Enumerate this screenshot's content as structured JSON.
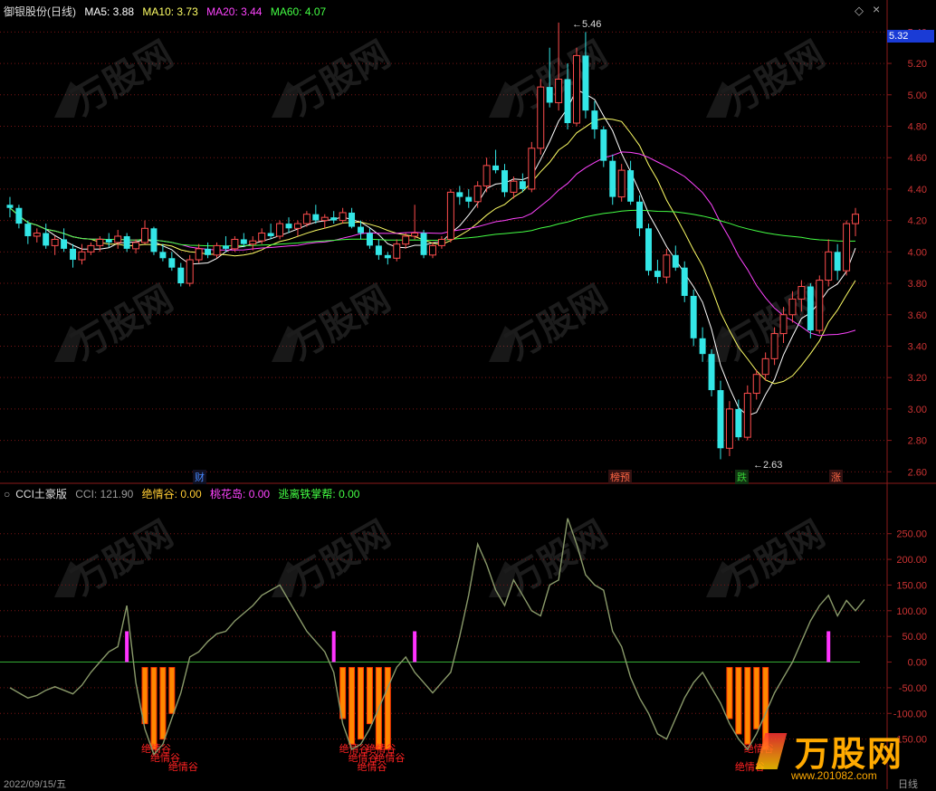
{
  "header": {
    "stock_title": "御银股份(日线)",
    "ma5": "MA5: 3.88",
    "ma10": "MA10: 3.73",
    "ma20": "MA20: 3.44",
    "ma60": "MA60: 4.07",
    "colors": {
      "ma5": "#ffffff",
      "ma10": "#ffff66",
      "ma20": "#ff44ff",
      "ma60": "#44ff44"
    }
  },
  "price_axis": {
    "current_price": "5.32",
    "ticks": [
      "5.40",
      "5.20",
      "5.00",
      "4.80",
      "4.60",
      "4.40",
      "4.20",
      "4.00",
      "3.80",
      "3.60",
      "3.40",
      "3.20",
      "3.00",
      "2.80",
      "2.60"
    ],
    "ylim": [
      2.55,
      5.5
    ]
  },
  "annotations": {
    "high_label": "5.46",
    "low_label": "2.63",
    "events": [
      {
        "text": "财",
        "color": "#4488ff"
      },
      {
        "text": "榜预",
        "color": "#ff6644"
      },
      {
        "text": "跌",
        "color": "#33cc33"
      },
      {
        "text": "涨",
        "color": "#ff6644"
      }
    ]
  },
  "indicator": {
    "title": "CCI土豪版",
    "cci": "CCI: 121.90",
    "jueqinggu": "绝情谷: 0.00",
    "taohuadao": "桃花岛: 0.00",
    "taolijunzhang": "逃离铁掌帮: 0.00",
    "ticks": [
      "250.00",
      "200.00",
      "150.00",
      "100.00",
      "50.00",
      "0.00",
      "-50.00",
      "-100.00",
      "-150.00"
    ],
    "ylim": [
      -230,
      320
    ],
    "signal_label": "绝情谷"
  },
  "bottom": {
    "date_label": "2022/09/15/五",
    "period_label": "日线"
  },
  "watermark": {
    "brand": "万股网",
    "url": "www.201082.com"
  },
  "chart_data": {
    "type": "candlestick",
    "ohlc": [
      [
        4.3,
        4.35,
        4.22,
        4.28
      ],
      [
        4.28,
        4.3,
        4.15,
        4.18
      ],
      [
        4.18,
        4.2,
        4.05,
        4.1
      ],
      [
        4.1,
        4.15,
        4.06,
        4.12
      ],
      [
        4.12,
        4.18,
        4.02,
        4.04
      ],
      [
        4.04,
        4.1,
        3.98,
        4.08
      ],
      [
        4.08,
        4.15,
        4.0,
        4.02
      ],
      [
        4.02,
        4.05,
        3.9,
        3.95
      ],
      [
        3.95,
        4.05,
        3.92,
        4.0
      ],
      [
        4.0,
        4.06,
        3.98,
        4.04
      ],
      [
        4.04,
        4.1,
        4.0,
        4.08
      ],
      [
        4.08,
        4.12,
        4.03,
        4.06
      ],
      [
        4.06,
        4.14,
        4.02,
        4.1
      ],
      [
        4.1,
        4.12,
        4.0,
        4.02
      ],
      [
        4.02,
        4.08,
        3.99,
        4.06
      ],
      [
        4.06,
        4.2,
        4.05,
        4.15
      ],
      [
        4.15,
        4.16,
        3.98,
        4.0
      ],
      [
        4.0,
        4.05,
        3.94,
        3.96
      ],
      [
        3.96,
        4.0,
        3.88,
        3.9
      ],
      [
        3.9,
        3.93,
        3.78,
        3.8
      ],
      [
        3.8,
        3.98,
        3.78,
        3.95
      ],
      [
        3.95,
        4.05,
        3.93,
        4.02
      ],
      [
        4.02,
        4.06,
        3.96,
        3.98
      ],
      [
        3.98,
        4.06,
        3.96,
        4.04
      ],
      [
        4.04,
        4.1,
        4.0,
        4.02
      ],
      [
        4.02,
        4.1,
        4.0,
        4.08
      ],
      [
        4.08,
        4.12,
        4.03,
        4.05
      ],
      [
        4.05,
        4.1,
        4.01,
        4.07
      ],
      [
        4.07,
        4.15,
        4.05,
        4.12
      ],
      [
        4.12,
        4.18,
        4.08,
        4.1
      ],
      [
        4.1,
        4.2,
        4.08,
        4.18
      ],
      [
        4.18,
        4.22,
        4.12,
        4.15
      ],
      [
        4.15,
        4.2,
        4.1,
        4.18
      ],
      [
        4.18,
        4.26,
        4.16,
        4.24
      ],
      [
        4.24,
        4.3,
        4.18,
        4.2
      ],
      [
        4.2,
        4.24,
        4.15,
        4.22
      ],
      [
        4.22,
        4.26,
        4.18,
        4.2
      ],
      [
        4.2,
        4.28,
        4.18,
        4.25
      ],
      [
        4.25,
        4.28,
        4.15,
        4.16
      ],
      [
        4.16,
        4.2,
        4.08,
        4.12
      ],
      [
        4.12,
        4.15,
        4.02,
        4.04
      ],
      [
        4.04,
        4.08,
        3.95,
        3.98
      ],
      [
        3.98,
        4.0,
        3.92,
        3.96
      ],
      [
        3.96,
        4.08,
        3.94,
        4.05
      ],
      [
        4.05,
        4.12,
        4.02,
        4.1
      ],
      [
        4.1,
        4.3,
        4.08,
        4.12
      ],
      [
        4.12,
        4.14,
        3.96,
        3.98
      ],
      [
        3.98,
        4.06,
        3.96,
        4.04
      ],
      [
        4.04,
        4.1,
        4.02,
        4.08
      ],
      [
        4.08,
        4.4,
        4.06,
        4.38
      ],
      [
        4.38,
        4.42,
        4.3,
        4.35
      ],
      [
        4.35,
        4.4,
        4.28,
        4.32
      ],
      [
        4.32,
        4.45,
        4.28,
        4.42
      ],
      [
        4.42,
        4.6,
        4.38,
        4.55
      ],
      [
        4.55,
        4.65,
        4.5,
        4.52
      ],
      [
        4.52,
        4.56,
        4.35,
        4.38
      ],
      [
        4.38,
        4.48,
        4.34,
        4.45
      ],
      [
        4.45,
        4.5,
        4.38,
        4.4
      ],
      [
        4.4,
        4.7,
        4.38,
        4.66
      ],
      [
        4.66,
        5.1,
        4.62,
        5.05
      ],
      [
        5.05,
        5.3,
        4.92,
        4.95
      ],
      [
        4.95,
        5.46,
        4.9,
        5.1
      ],
      [
        5.1,
        5.2,
        4.78,
        4.82
      ],
      [
        4.82,
        5.3,
        4.8,
        5.25
      ],
      [
        5.25,
        5.4,
        4.85,
        4.9
      ],
      [
        4.9,
        4.96,
        4.72,
        4.78
      ],
      [
        4.78,
        4.8,
        4.54,
        4.58
      ],
      [
        4.58,
        4.62,
        4.3,
        4.35
      ],
      [
        4.35,
        4.56,
        4.32,
        4.52
      ],
      [
        4.52,
        4.58,
        4.3,
        4.32
      ],
      [
        4.32,
        4.36,
        4.1,
        4.15
      ],
      [
        4.15,
        4.18,
        3.85,
        3.88
      ],
      [
        3.88,
        3.95,
        3.8,
        3.84
      ],
      [
        3.84,
        4.02,
        3.8,
        3.98
      ],
      [
        3.98,
        4.04,
        3.88,
        3.9
      ],
      [
        3.9,
        3.94,
        3.68,
        3.72
      ],
      [
        3.72,
        3.76,
        3.4,
        3.45
      ],
      [
        3.45,
        3.52,
        3.3,
        3.35
      ],
      [
        3.35,
        3.38,
        3.08,
        3.12
      ],
      [
        3.12,
        3.18,
        2.68,
        2.75
      ],
      [
        2.75,
        3.05,
        2.7,
        3.0
      ],
      [
        3.0,
        3.06,
        2.8,
        2.82
      ],
      [
        2.82,
        3.15,
        2.8,
        3.1
      ],
      [
        3.1,
        3.25,
        3.06,
        3.22
      ],
      [
        3.22,
        3.36,
        3.18,
        3.32
      ],
      [
        3.32,
        3.52,
        3.28,
        3.48
      ],
      [
        3.48,
        3.65,
        3.42,
        3.6
      ],
      [
        3.6,
        3.75,
        3.55,
        3.7
      ],
      [
        3.7,
        3.82,
        3.62,
        3.78
      ],
      [
        3.78,
        3.8,
        3.45,
        3.5
      ],
      [
        3.5,
        3.85,
        3.48,
        3.82
      ],
      [
        3.82,
        4.08,
        3.78,
        4.0
      ],
      [
        4.0,
        4.05,
        3.82,
        3.88
      ],
      [
        3.88,
        4.2,
        3.85,
        4.18
      ],
      [
        4.18,
        4.28,
        4.1,
        4.24
      ]
    ],
    "cci": [
      -50,
      -60,
      -70,
      -65,
      -55,
      -48,
      -55,
      -62,
      -45,
      -20,
      0,
      20,
      30,
      110,
      -40,
      -130,
      -180,
      -160,
      -110,
      -60,
      10,
      20,
      40,
      55,
      60,
      80,
      95,
      110,
      130,
      140,
      150,
      120,
      90,
      60,
      40,
      20,
      -20,
      -120,
      -170,
      -160,
      -130,
      -90,
      -50,
      -10,
      10,
      -20,
      -40,
      -60,
      -40,
      -20,
      50,
      130,
      230,
      190,
      140,
      110,
      160,
      130,
      100,
      90,
      150,
      160,
      280,
      230,
      170,
      150,
      140,
      60,
      30,
      -30,
      -70,
      -100,
      -140,
      -150,
      -110,
      -70,
      -40,
      -20,
      -50,
      -80,
      -120,
      -150,
      -170,
      -140,
      -100,
      -60,
      -30,
      0,
      40,
      80,
      110,
      130,
      90,
      120,
      100,
      121.9
    ],
    "signals": {
      "jueqinggu_bars": [
        15,
        16,
        17,
        18,
        37,
        38,
        39,
        40,
        41,
        42,
        80,
        81,
        82,
        83,
        84
      ],
      "taohuadao_bars": [
        13,
        36,
        45,
        91
      ],
      "signal_text_bars": [
        15,
        16,
        18,
        37,
        38,
        39,
        40,
        41,
        81,
        82
      ]
    }
  }
}
